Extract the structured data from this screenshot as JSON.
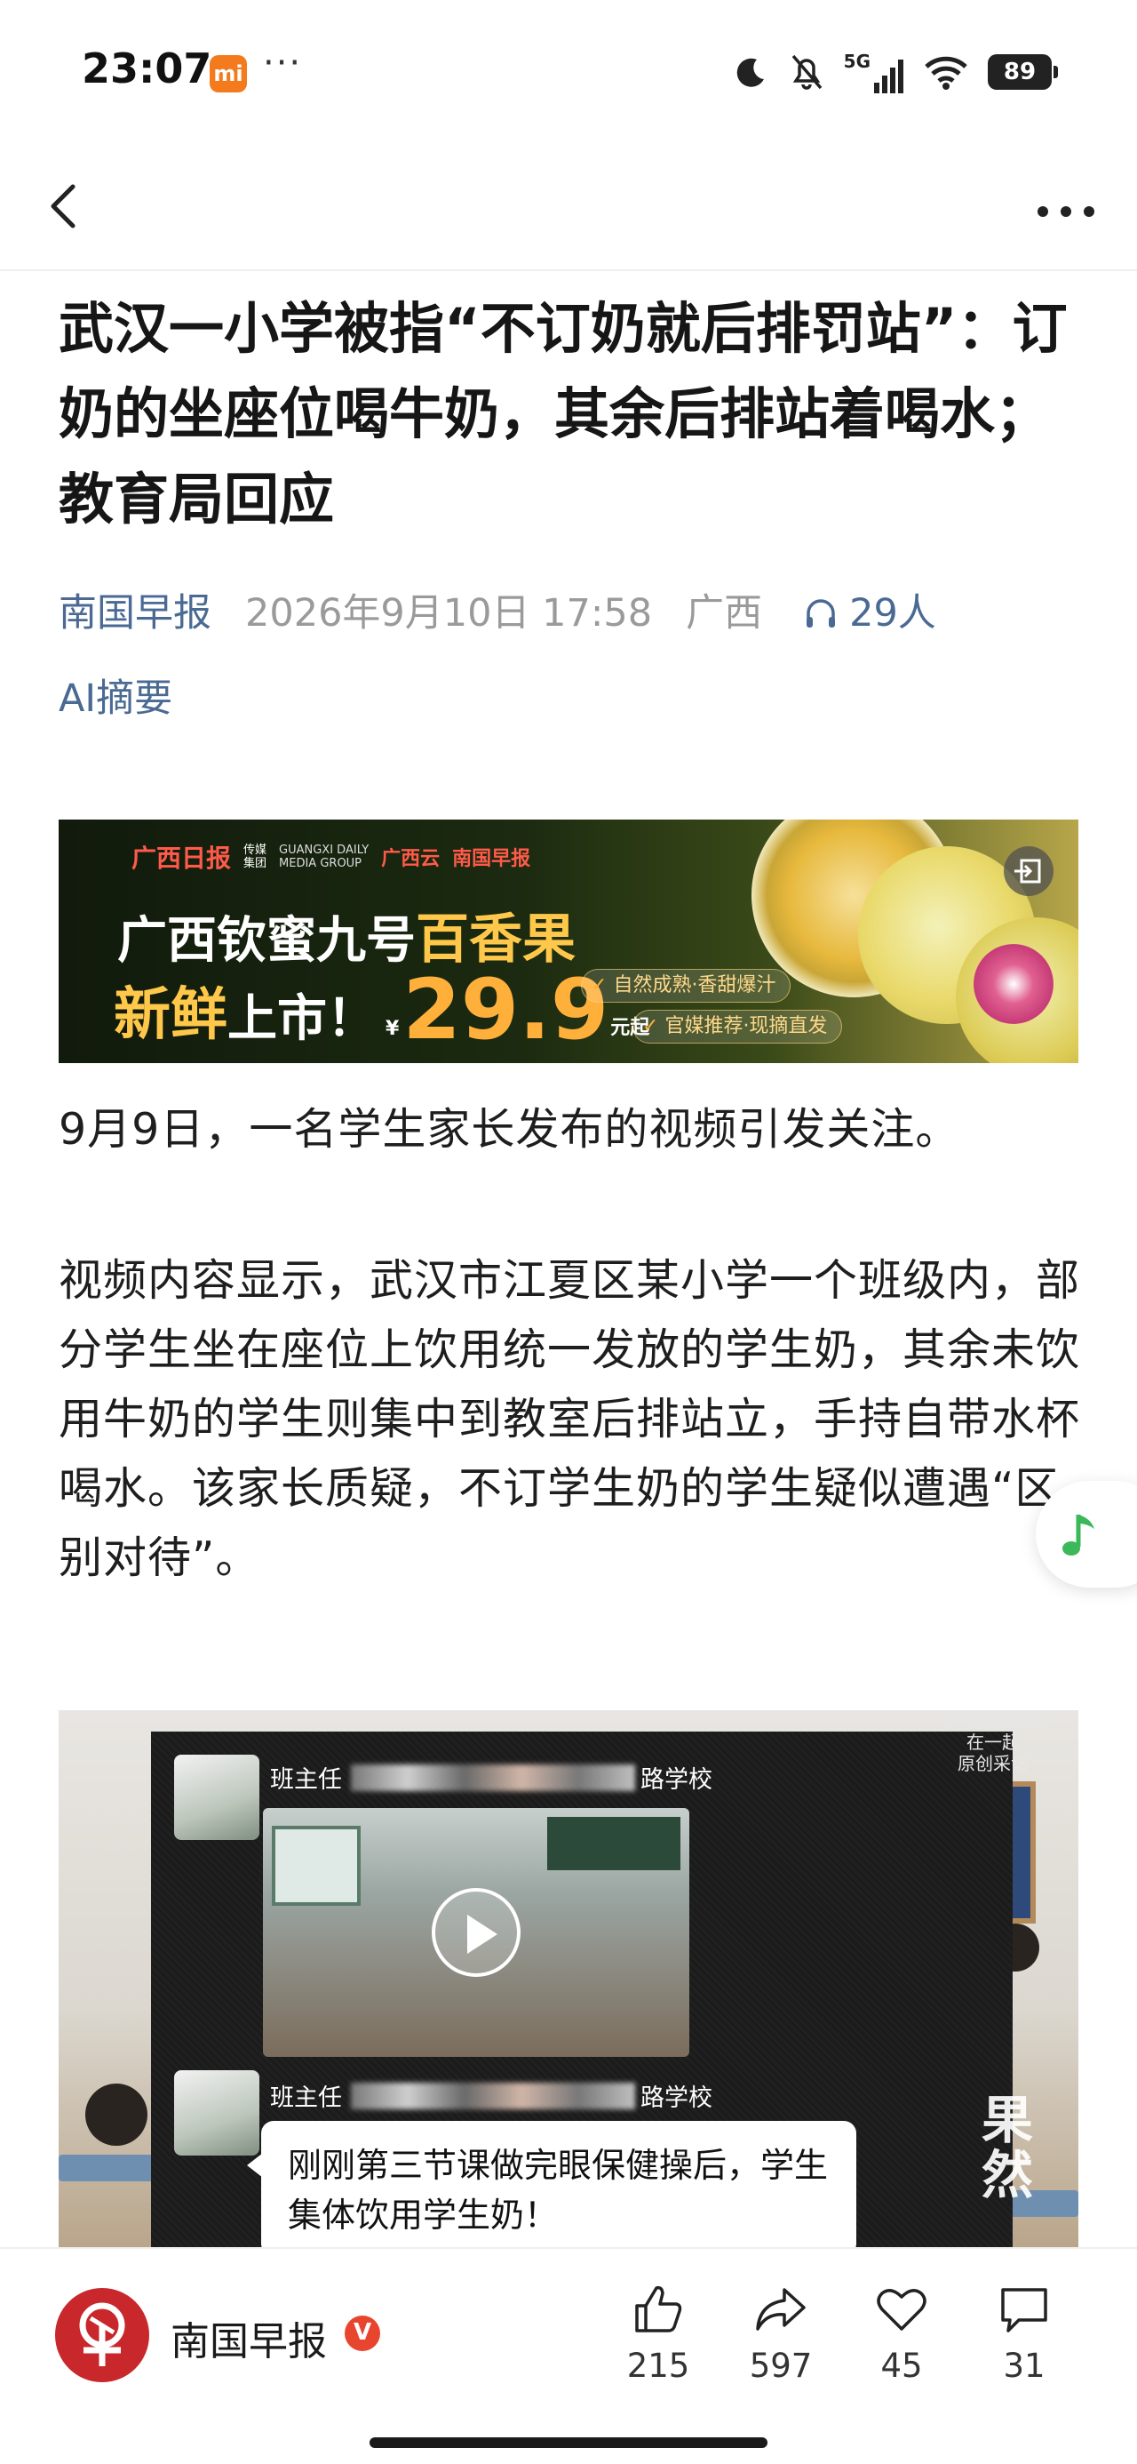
{
  "status_bar": {
    "time": "23:07",
    "mi_badge": "mi",
    "dots": "···",
    "network": "5G",
    "battery": "89",
    "icons": [
      "moon-icon",
      "bell-off-icon",
      "signal-icon",
      "wifi-icon",
      "battery-icon"
    ]
  },
  "nav": {
    "back_icon": "chevron-left-icon",
    "more_icon": "more-horizontal-icon"
  },
  "article": {
    "title": "武汉一小学被指“不订奶就后排罚站”：订奶的坐座位喝牛奶，其余后排站着喝水；教育局回应",
    "source": "南国早报",
    "date": "2026年9月10日 17:58",
    "region": "广西",
    "listeners": "29人",
    "ai_summary": "AI摘要",
    "paragraphs": [
      "9月9日，一名学生家长发布的视频引发关注。",
      "视频内容显示，武汉市江夏区某小学一个班级内，部分学生坐在座位上饮用统一发放的学生奶，其余未饮用牛奶的学生则集中到教室后排站立，手持自带水杯喝水。该家长质疑，不订学生奶的学生疑似遭遇“区别对待”。"
    ]
  },
  "ad": {
    "logo_text": "广西日报",
    "group_cn_1": "传媒",
    "group_cn_2": "集团",
    "group_en_1": "GUANGXI DAILY",
    "group_en_2": "MEDIA GROUP",
    "logo_2": "广西云",
    "logo_3": "南国早报",
    "line1_prefix": "广西钦蜜九号",
    "line1_highlight": "百香果",
    "line2_fresh": "新鲜",
    "line2_rest": "上市！",
    "currency": "¥",
    "price": "29.9",
    "price_suffix": "元起",
    "tag1": "自然成熟·香甜爆汁",
    "tag2": "官媒推荐·现摘直发",
    "exit_icon": "exit-icon"
  },
  "video": {
    "watermark_1": "平时就像结合在一起",
    "watermark_2": "原创采访",
    "chat_name_1_prefix": "班主任",
    "chat_name_1_suffix": "路学校",
    "chat_name_2_prefix": "班主任",
    "chat_name_2_suffix": "路学校",
    "bubble_text": "刚刚第三节课做完眼保健操后，学生集体饮用学生奶！",
    "brand_stamp": "果然",
    "play_icon": "play-icon"
  },
  "bottom_bar": {
    "author": "南国早报",
    "verified": "V",
    "actions": [
      {
        "icon": "thumbs-up-icon",
        "count": "215"
      },
      {
        "icon": "share-icon",
        "count": "597"
      },
      {
        "icon": "heart-icon",
        "count": "45"
      },
      {
        "icon": "comment-icon",
        "count": "31"
      }
    ]
  },
  "colors": {
    "link_blue": "#4a6a94",
    "meta_gray": "#9a9a9a",
    "brand_red": "#c8272b",
    "ad_gold": "#ffc84a",
    "fab_green": "#3bb85a"
  }
}
